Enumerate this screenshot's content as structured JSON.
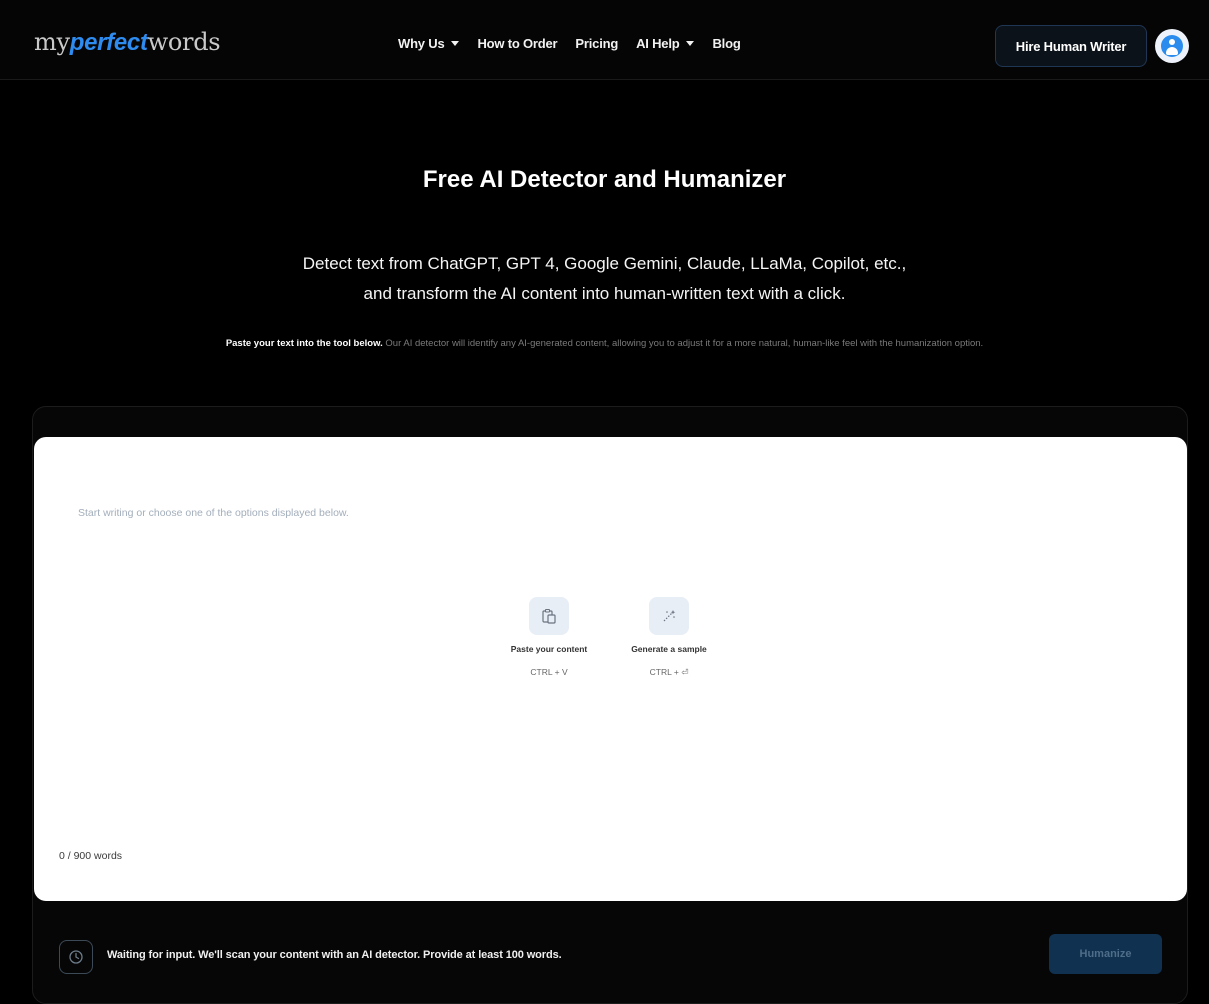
{
  "header": {
    "logo": {
      "part1": "my",
      "part2": "perfect",
      "part3": "words"
    },
    "nav": [
      {
        "label": "Why Us",
        "dropdown": true
      },
      {
        "label": "How to Order",
        "dropdown": false
      },
      {
        "label": "Pricing",
        "dropdown": false
      },
      {
        "label": "AI Help",
        "dropdown": true
      },
      {
        "label": "Blog",
        "dropdown": false
      }
    ],
    "hire_button": "Hire Human Writer",
    "avatar_icon": "user-icon"
  },
  "hero": {
    "title": "Free AI Detector and Humanizer",
    "subtitle_line1": "Detect text from ChatGPT, GPT 4, Google Gemini, Claude, LLaMa, Copilot, etc.,",
    "subtitle_line2": "and transform the AI content into human-written text with a click.",
    "desc_bold": "Paste your text into the tool below.",
    "desc_rest": " Our AI detector will identify any AI-generated content, allowing you to adjust it for a more natural, human-like feel with the humanization option."
  },
  "editor": {
    "placeholder": "Start writing or choose one of the options displayed below.",
    "options": [
      {
        "label": "Paste your content",
        "shortcut": "CTRL + V",
        "icon": "clipboard-icon"
      },
      {
        "label": "Generate a sample",
        "shortcut": "CTRL + ⏎",
        "icon": "sparkle-icon"
      }
    ],
    "word_count": "0 / 900 words"
  },
  "status": {
    "icon": "clock-icon",
    "text": "Waiting for input. We'll scan your content with an AI detector. Provide at least 100 words.",
    "button": "Humanize"
  },
  "colors": {
    "accent": "#2e8cf0",
    "background": "#000000",
    "button_disabled": "#10314f"
  }
}
